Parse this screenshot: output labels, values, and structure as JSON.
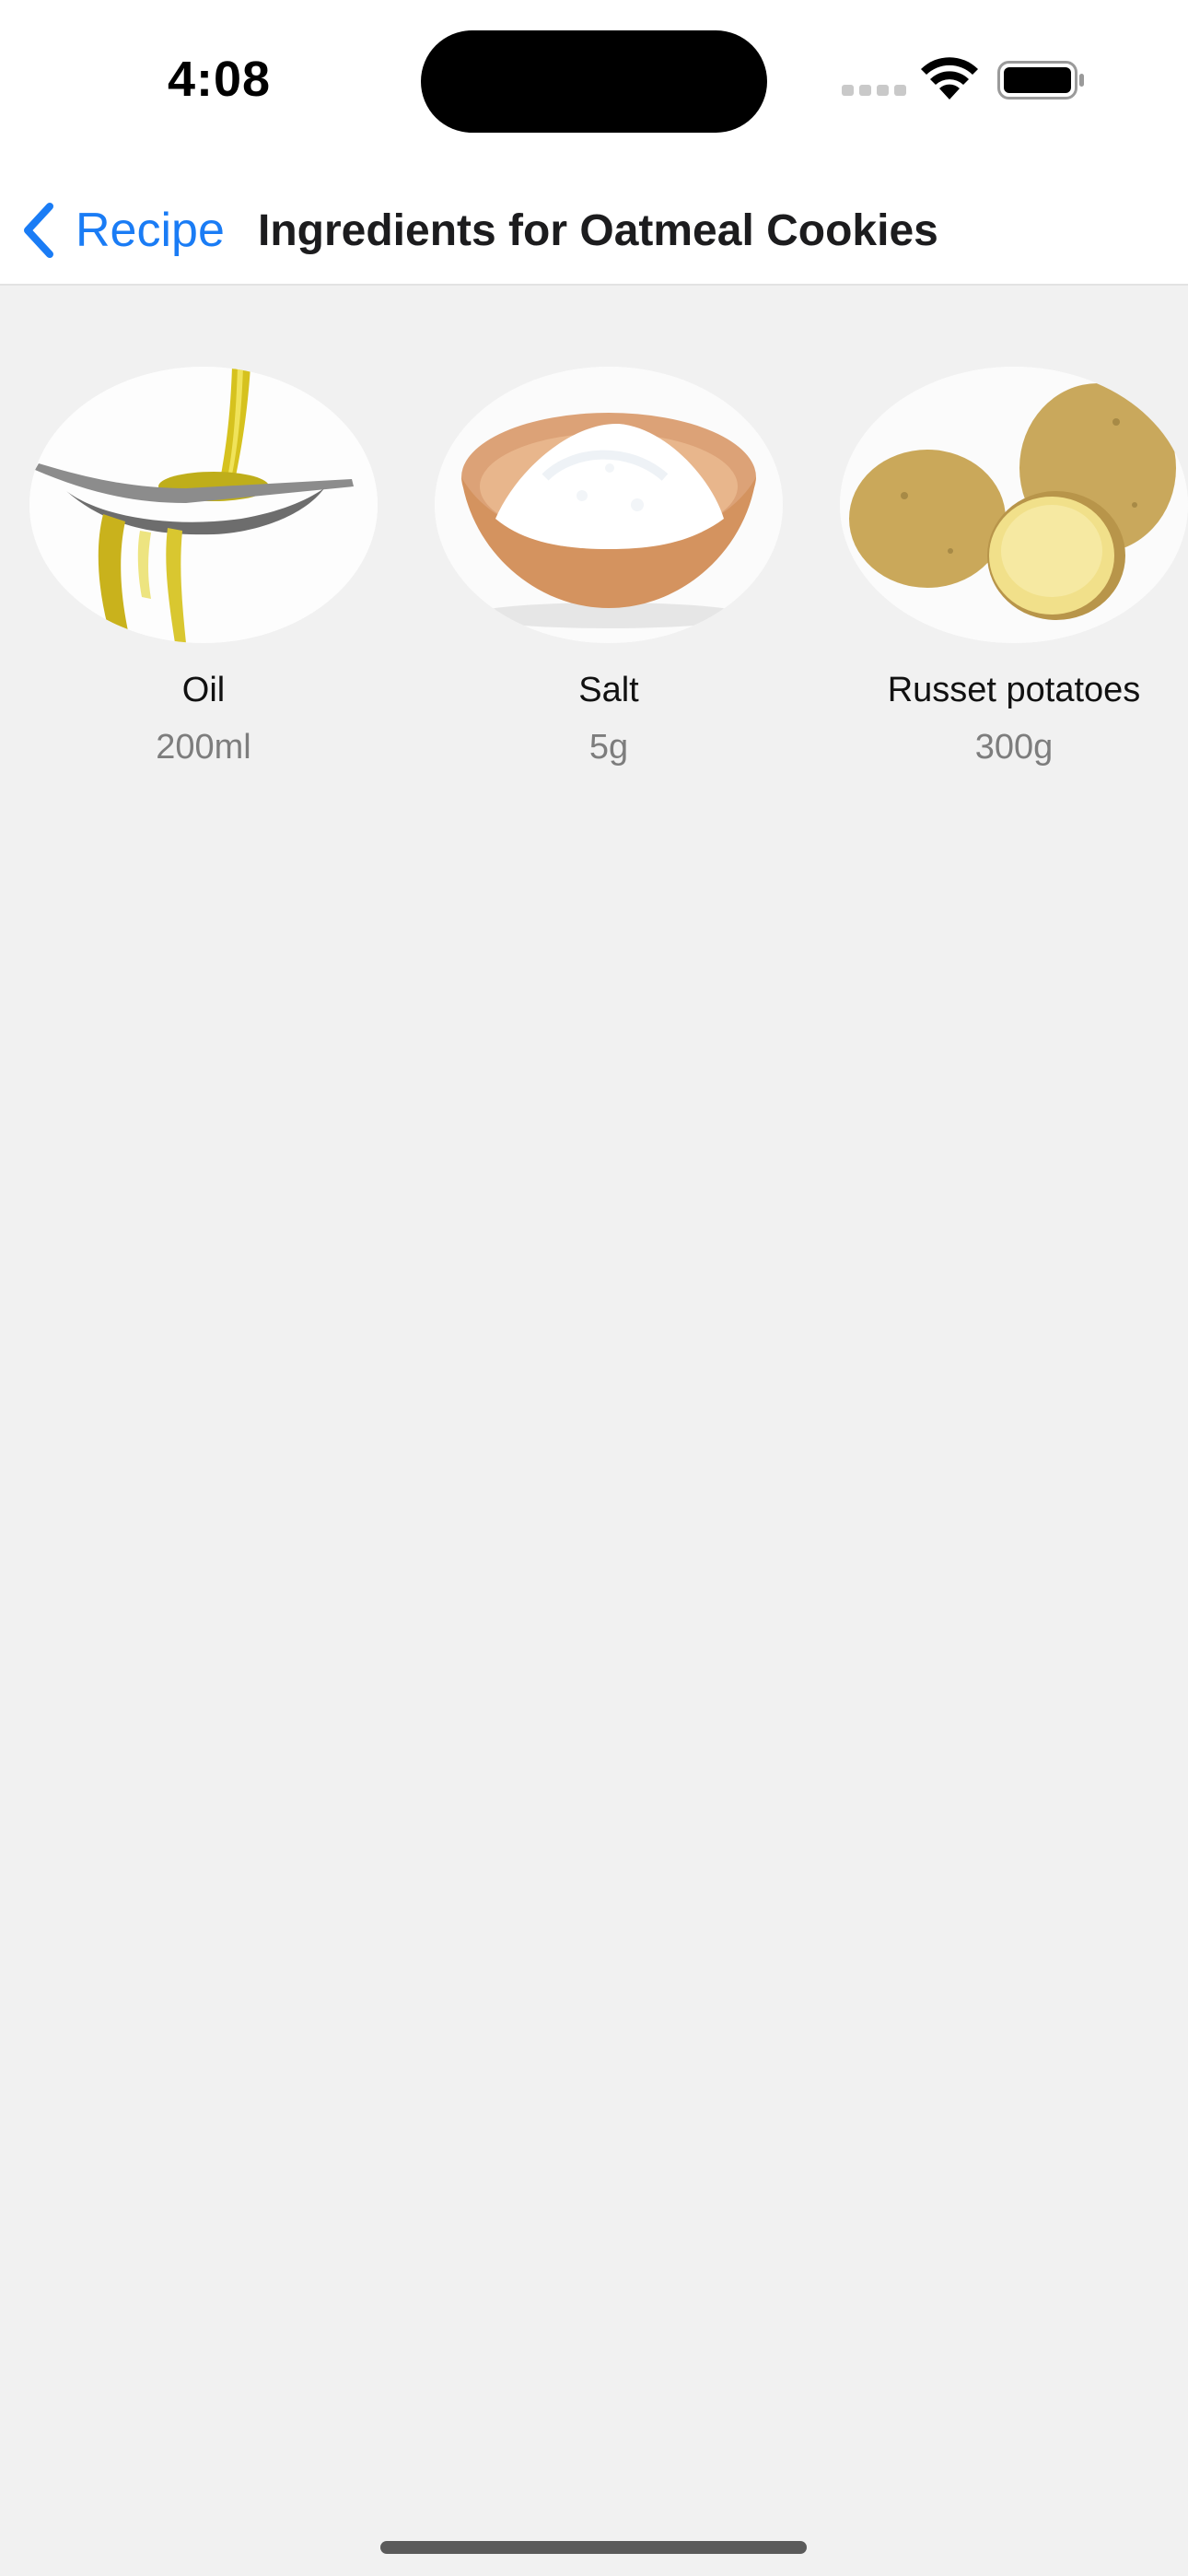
{
  "status_bar": {
    "time": "4:08"
  },
  "nav": {
    "back_label": "Recipe",
    "title": "Ingredients for Oatmeal Cookies",
    "accent_color": "#1a7cf5"
  },
  "ingredients": [
    {
      "name": "Oil",
      "quantity": "200ml",
      "image": "olive-oil-spoon"
    },
    {
      "name": "Salt",
      "quantity": "5g",
      "image": "salt-bowl"
    },
    {
      "name": "Russet potatoes",
      "quantity": "300g",
      "image": "potatoes"
    }
  ]
}
